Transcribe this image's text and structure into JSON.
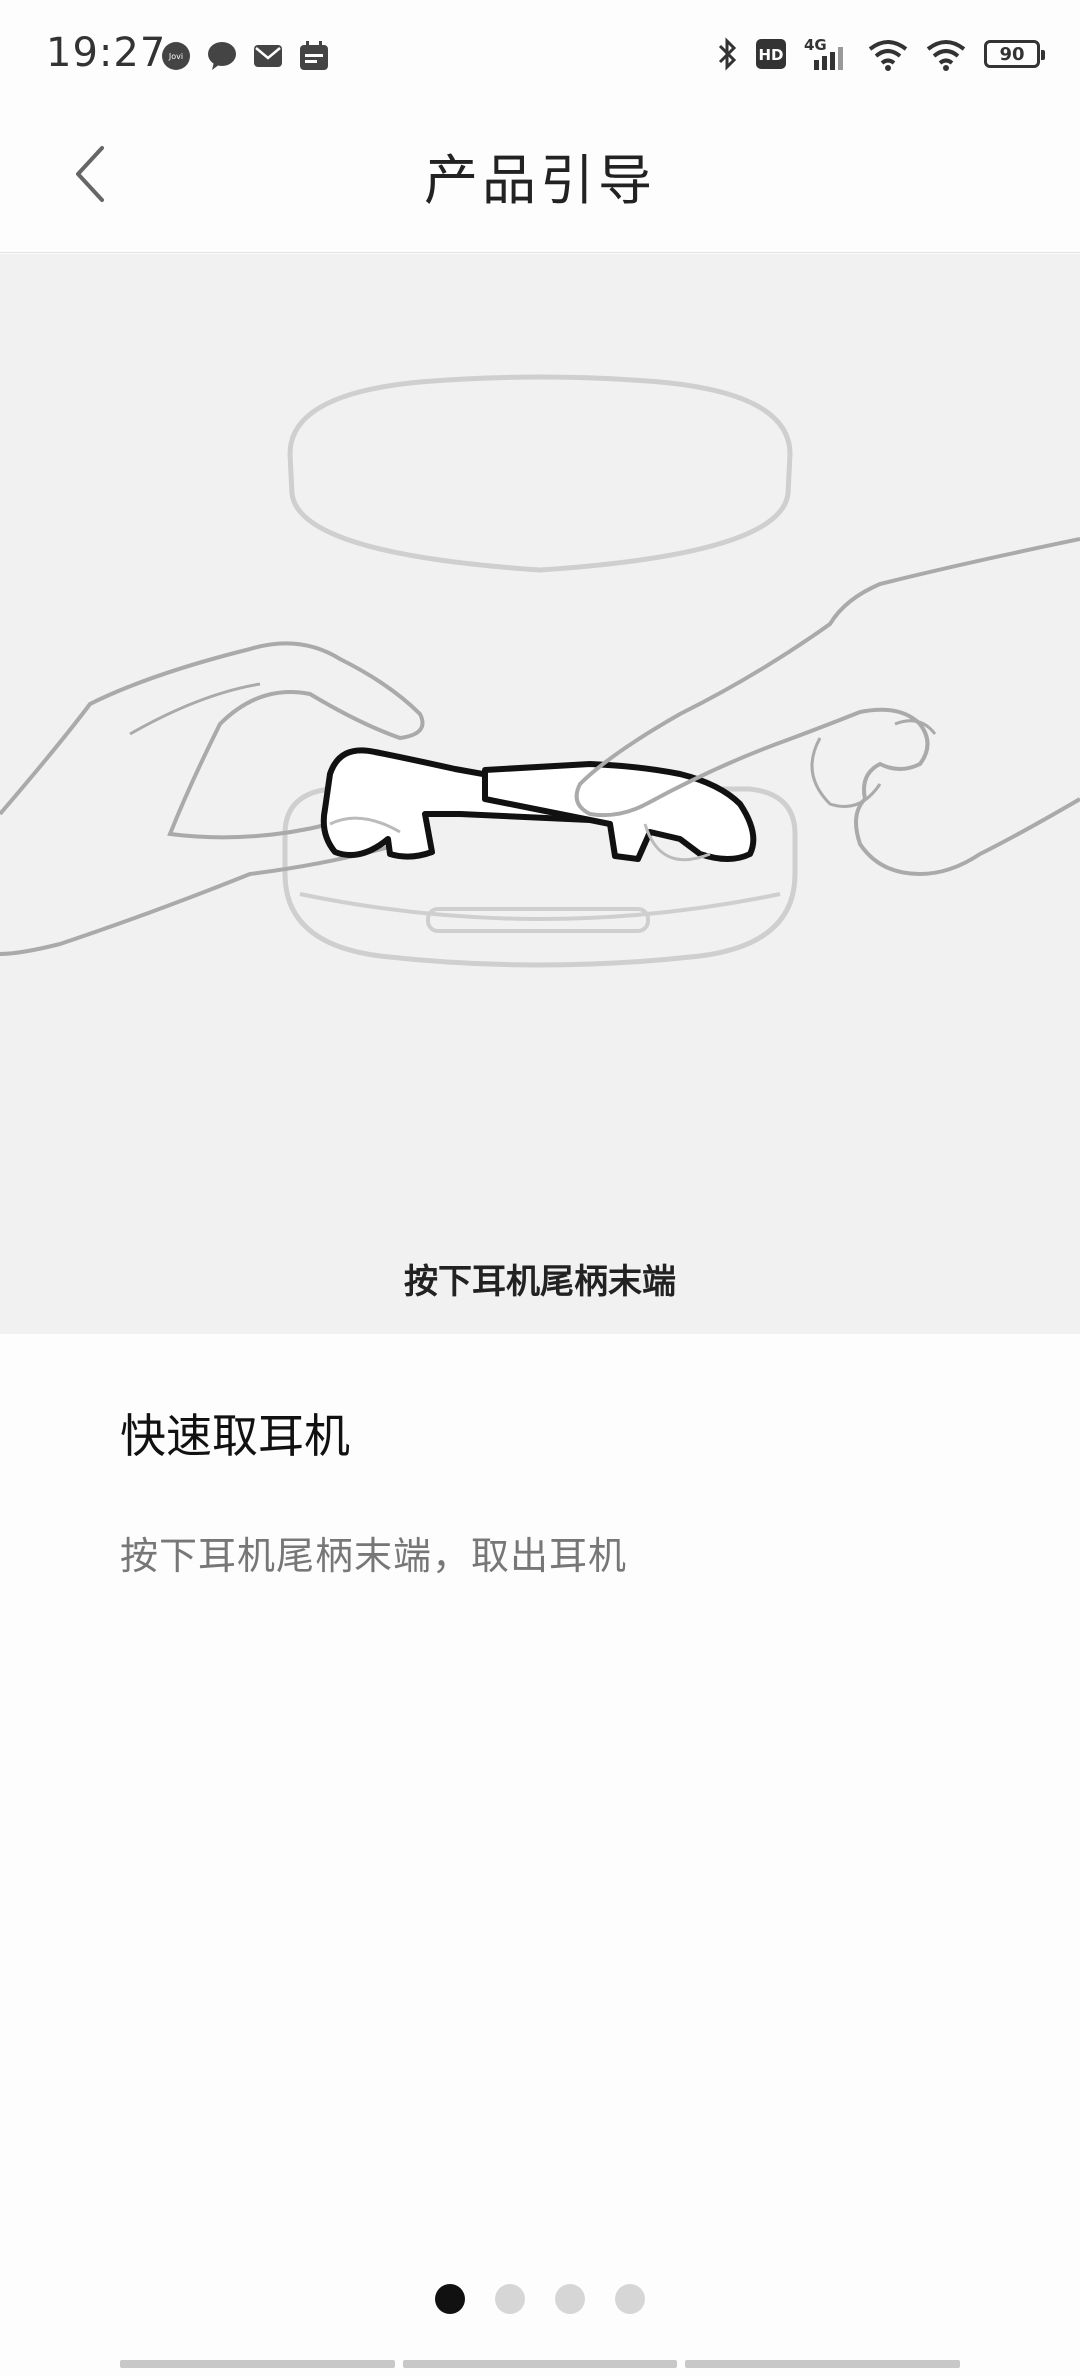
{
  "status_bar": {
    "time": "19:27",
    "notification_icons": [
      "jovi-icon",
      "message-icon",
      "mail-icon",
      "calendar-icon"
    ],
    "system_icons": [
      "bluetooth-icon",
      "hd-icon",
      "4g-signal-icon",
      "wifi-hotspot-icon",
      "wifi-icon"
    ],
    "hd_label": "HD",
    "network_label": "4G",
    "battery_level": "90"
  },
  "header": {
    "title": "产品引导",
    "back_icon": "chevron-left-icon"
  },
  "illustration": {
    "caption": "按下耳机尾柄末端",
    "subject": "earbuds-case-hands"
  },
  "guide": {
    "title": "快速取耳机",
    "description": "按下耳机尾柄末端，取出耳机"
  },
  "pagination": {
    "total": 4,
    "active_index": 0
  },
  "colors": {
    "background": "#fdfdfd",
    "illustration_bg": "#f1f1f1",
    "dot_active": "#111111",
    "dot_inactive": "#d6d6d6",
    "description_text": "#777777"
  }
}
